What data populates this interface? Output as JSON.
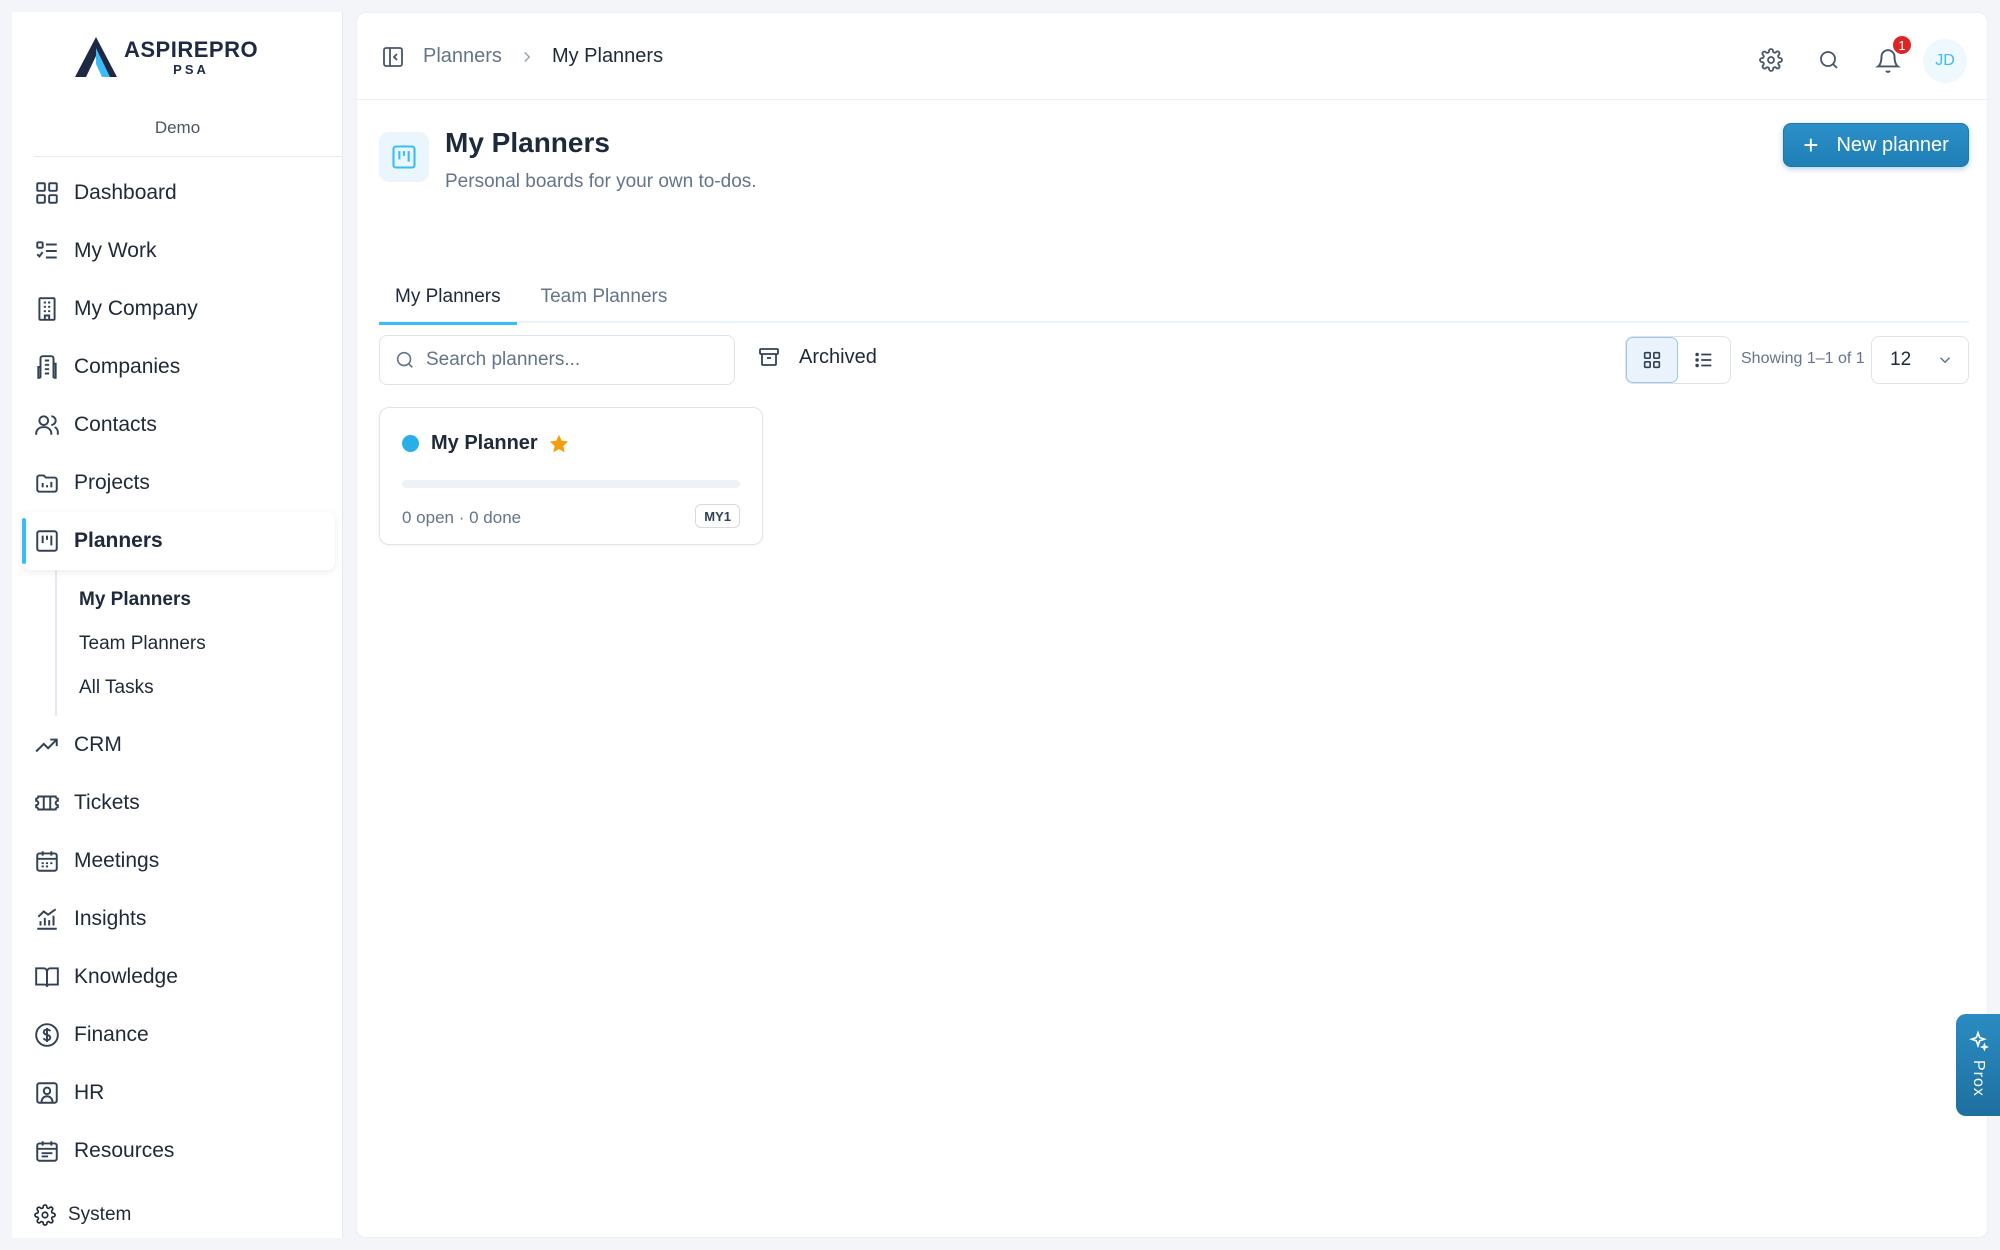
{
  "brand": {
    "name": "ASPIREPRO",
    "sub": "PSA",
    "org": "Demo",
    "accent": "#38bdf8",
    "primary": "#1f7fb6"
  },
  "sidebar": {
    "items": [
      {
        "label": "Dashboard",
        "icon": "dashboard-grid-icon"
      },
      {
        "label": "My Work",
        "icon": "checklist-icon"
      },
      {
        "label": "My Company",
        "icon": "building-icon"
      },
      {
        "label": "Companies",
        "icon": "buildings-icon"
      },
      {
        "label": "Contacts",
        "icon": "users-icon"
      },
      {
        "label": "Projects",
        "icon": "folder-chart-icon"
      },
      {
        "label": "Planners",
        "icon": "kanban-icon",
        "active": true
      },
      {
        "label": "CRM",
        "icon": "trend-up-icon"
      },
      {
        "label": "Tickets",
        "icon": "ticket-icon"
      },
      {
        "label": "Meetings",
        "icon": "calendar-icon"
      },
      {
        "label": "Insights",
        "icon": "bar-chart-icon"
      },
      {
        "label": "Knowledge",
        "icon": "book-icon"
      },
      {
        "label": "Finance",
        "icon": "dollar-icon"
      },
      {
        "label": "HR",
        "icon": "id-badge-icon"
      },
      {
        "label": "Resources",
        "icon": "calendar-grid-icon"
      }
    ],
    "planner_sub": [
      "My Planners",
      "Team Planners",
      "All Tasks"
    ],
    "system": "System"
  },
  "topbar": {
    "breadcrumb": [
      "Planners",
      "My Planners"
    ],
    "notifications": "1",
    "avatar": "JD"
  },
  "page": {
    "title": "My Planners",
    "subtitle": "Personal boards for your own to-dos.",
    "new_button": "New planner"
  },
  "tabs": [
    "My Planners",
    "Team Planners"
  ],
  "toolbar": {
    "search_placeholder": "Search planners...",
    "archived": "Archived",
    "showing": "Showing 1–1 of 1",
    "page_size": "12"
  },
  "planners": [
    {
      "name": "My Planner",
      "color": "#2aaee8",
      "starred": true,
      "open": "0 open",
      "done": "0 done",
      "key": "MY1",
      "progress": 0
    }
  ],
  "assistant": {
    "label": "Prox"
  }
}
